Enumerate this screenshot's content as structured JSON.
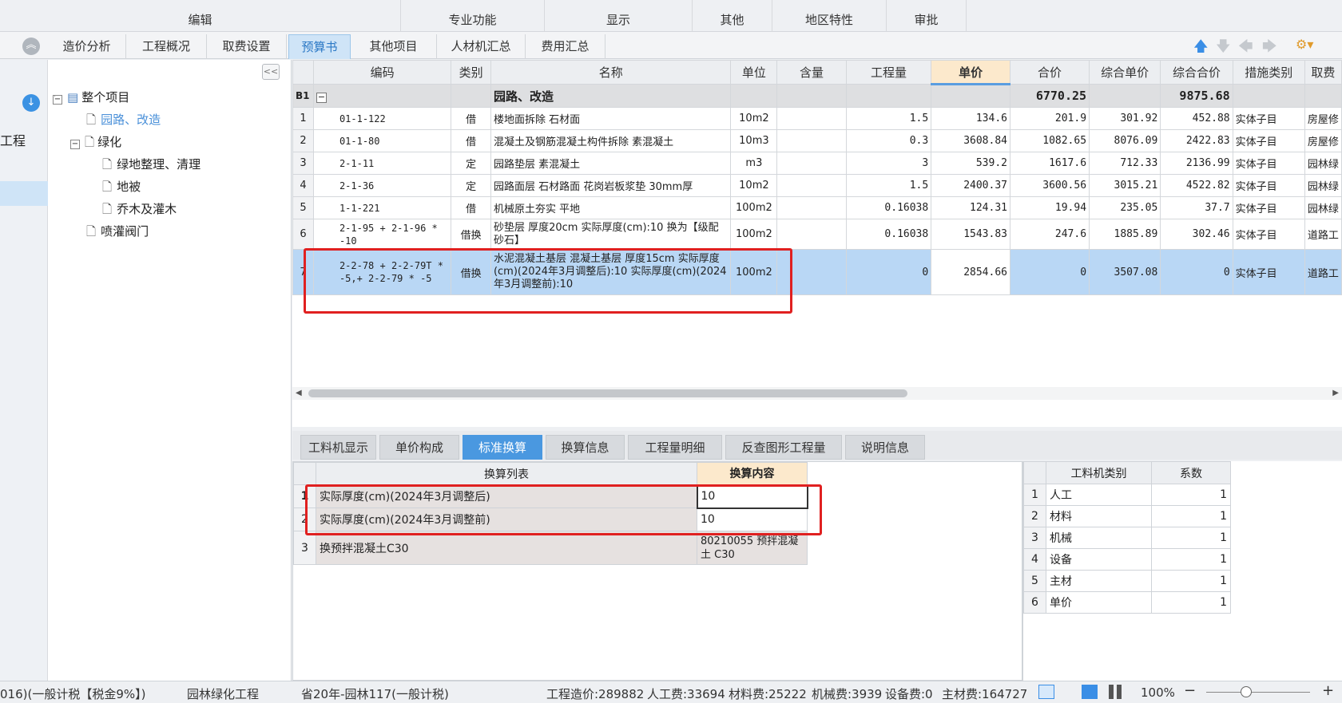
{
  "ribbon": {
    "groups": [
      "编辑",
      "专业功能",
      "显示",
      "其他",
      "地区特性",
      "审批"
    ]
  },
  "tabs": [
    "造价分析",
    "工程概况",
    "取费设置",
    "预算书",
    "其他项目",
    "人材机汇总",
    "费用汇总"
  ],
  "leftnav": {
    "partial_label": "工程"
  },
  "tree": {
    "root": "整个项目",
    "items": [
      "园路、改造",
      "绿化",
      "绿地整理、清理",
      "地被",
      "乔木及灌木",
      "喷灌阀门"
    ]
  },
  "grid": {
    "headers": [
      "编码",
      "类别",
      "名称",
      "单位",
      "含量",
      "工程量",
      "单价",
      "合价",
      "综合单价",
      "综合合价",
      "措施类别",
      "取费"
    ],
    "group": {
      "id": "B1",
      "name": "园路、改造",
      "total": "6770.25",
      "comp_total": "9875.68"
    },
    "rows": [
      {
        "n": "1",
        "code": "01-1-122",
        "type": "借",
        "name": "楼地面拆除 石材面",
        "unit": "10m2",
        "qty": "1.5",
        "price": "134.6",
        "total": "201.9",
        "cprice": "301.92",
        "ctotal": "452.88",
        "measure": "实体子目",
        "fee": "房屋修"
      },
      {
        "n": "2",
        "code": "01-1-80",
        "type": "借",
        "name": "混凝土及钢筋混凝土构件拆除 素混凝土",
        "unit": "10m3",
        "qty": "0.3",
        "price": "3608.84",
        "total": "1082.65",
        "cprice": "8076.09",
        "ctotal": "2422.83",
        "measure": "实体子目",
        "fee": "房屋修"
      },
      {
        "n": "3",
        "code": "2-1-11",
        "type": "定",
        "name": "园路垫层 素混凝土",
        "unit": "m3",
        "qty": "3",
        "price": "539.2",
        "total": "1617.6",
        "cprice": "712.33",
        "ctotal": "2136.99",
        "measure": "实体子目",
        "fee": "园林绿"
      },
      {
        "n": "4",
        "code": "2-1-36",
        "type": "定",
        "name": "园路面层 石材路面 花岗岩板浆垫 30mm厚",
        "unit": "10m2",
        "qty": "1.5",
        "price": "2400.37",
        "total": "3600.56",
        "cprice": "3015.21",
        "ctotal": "4522.82",
        "measure": "实体子目",
        "fee": "园林绿"
      },
      {
        "n": "5",
        "code": "1-1-221",
        "type": "借",
        "name": "机械原土夯实 平地",
        "unit": "100m2",
        "qty": "0.16038",
        "price": "124.31",
        "total": "19.94",
        "cprice": "235.05",
        "ctotal": "37.7",
        "measure": "实体子目",
        "fee": "园林绿"
      },
      {
        "n": "6",
        "code": "2-1-95 + 2-1-96 * -10",
        "type": "借换",
        "name": "砂垫层 厚度20cm  实际厚度(cm):10  换为【级配砂石】",
        "unit": "100m2",
        "qty": "0.16038",
        "price": "1543.83",
        "total": "247.6",
        "cprice": "1885.89",
        "ctotal": "302.46",
        "measure": "实体子目",
        "fee": "道路工"
      },
      {
        "n": "7",
        "code": "2-2-78 + 2-2-79T * -5,+ 2-2-79 * -5",
        "type": "借换",
        "name": "水泥混凝土基层 混凝土基层 厚度15cm  实际厚度(cm)(2024年3月调整后):10  实际厚度(cm)(2024年3月调整前):10",
        "unit": "100m2",
        "qty": "0",
        "price": "2854.66",
        "total": "0",
        "cprice": "3507.08",
        "ctotal": "0",
        "measure": "实体子目",
        "fee": "道路工"
      }
    ]
  },
  "bottom_tabs": [
    "工料机显示",
    "单价构成",
    "标准换算",
    "换算信息",
    "工程量明细",
    "反查图形工程量",
    "说明信息"
  ],
  "conv": {
    "headers": [
      "换算列表",
      "换算内容"
    ],
    "rows": [
      {
        "n": "1",
        "label": "实际厚度(cm)(2024年3月调整后)",
        "value": "10"
      },
      {
        "n": "2",
        "label": "实际厚度(cm)(2024年3月调整前)",
        "value": "10"
      },
      {
        "n": "3",
        "label": "换预拌混凝土C30",
        "value": "80210055  预拌混凝土 C30"
      }
    ]
  },
  "coef": {
    "headers": [
      "工料机类别",
      "系数"
    ],
    "rows": [
      {
        "n": "1",
        "cat": "人工",
        "k": "1"
      },
      {
        "n": "2",
        "cat": "材料",
        "k": "1"
      },
      {
        "n": "3",
        "cat": "机械",
        "k": "1"
      },
      {
        "n": "4",
        "cat": "设备",
        "k": "1"
      },
      {
        "n": "5",
        "cat": "主材",
        "k": "1"
      },
      {
        "n": "6",
        "cat": "单价",
        "k": "1"
      }
    ]
  },
  "status": {
    "tax": "016)(一般计税【税金9%】)",
    "project": "园林绿化工程",
    "quota": "省20年-园林117(一般计税)",
    "cost": "工程造价:289882",
    "labor": "人工费:33694",
    "material": "材料费:25222",
    "machine": "机械费:3939",
    "equip": "设备费:0",
    "main": "主材费:164727",
    "zoom": "100%"
  }
}
